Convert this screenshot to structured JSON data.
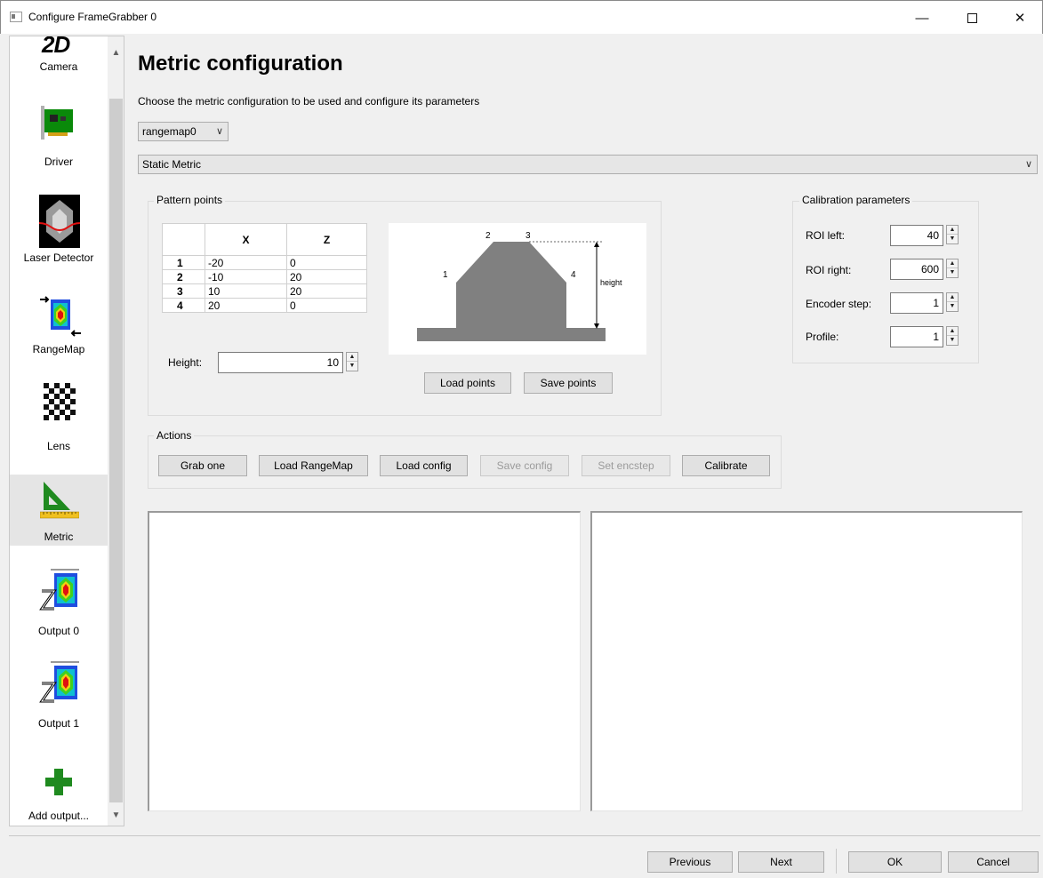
{
  "window": {
    "title": "Configure FrameGrabber 0",
    "minimize": "—",
    "close": "✕"
  },
  "sidebar": {
    "items": [
      {
        "label": "Camera",
        "icon": "2d-camera-icon"
      },
      {
        "label": "Driver",
        "icon": "pci-card-icon"
      },
      {
        "label": "Laser Detector",
        "icon": "laser-detector-icon"
      },
      {
        "label": "RangeMap",
        "icon": "rangemap-icon"
      },
      {
        "label": "Lens",
        "icon": "checkerboard-icon"
      },
      {
        "label": "Metric",
        "icon": "set-square-ruler-icon",
        "selected": true
      },
      {
        "label": "Output 0",
        "icon": "output-z-icon"
      },
      {
        "label": "Output 1",
        "icon": "output-z-icon"
      },
      {
        "label": "Add output...",
        "icon": "green-plus-icon"
      }
    ],
    "camera_glyph": "2D"
  },
  "main": {
    "title": "Metric configuration",
    "subtitle": "Choose the metric configuration to be used and configure its parameters",
    "source_combo": "rangemap0",
    "metric_combo": "Static Metric"
  },
  "pattern_points": {
    "title": "Pattern points",
    "columns": [
      "X",
      "Z"
    ],
    "rows": [
      {
        "id": "1",
        "x": "-20",
        "z": "0"
      },
      {
        "id": "2",
        "x": "-10",
        "z": "20"
      },
      {
        "id": "3",
        "x": "10",
        "z": "20"
      },
      {
        "id": "4",
        "x": "20",
        "z": "0"
      }
    ],
    "height_label": "Height:",
    "height_value": "10",
    "diagram": {
      "labels": [
        "1",
        "2",
        "3",
        "4"
      ],
      "height_text": "height"
    },
    "load_button": "Load points",
    "save_button": "Save points"
  },
  "calibration": {
    "title": "Calibration parameters",
    "fields": [
      {
        "label": "ROI left:",
        "value": "40"
      },
      {
        "label": "ROI right:",
        "value": "600"
      },
      {
        "label": "Encoder step:",
        "value": "1"
      },
      {
        "label": "Profile:",
        "value": "1"
      }
    ]
  },
  "actions": {
    "title": "Actions",
    "buttons": [
      {
        "label": "Grab one",
        "enabled": true
      },
      {
        "label": "Load RangeMap",
        "enabled": true
      },
      {
        "label": "Load config",
        "enabled": true
      },
      {
        "label": "Save config",
        "enabled": false
      },
      {
        "label": "Set encstep",
        "enabled": false
      },
      {
        "label": "Calibrate",
        "enabled": true
      }
    ]
  },
  "footer": {
    "previous": "Previous",
    "next": "Next",
    "ok": "OK",
    "cancel": "Cancel"
  },
  "colors": {
    "accent_green": "#1f8a1f",
    "diagram_gray": "#808080",
    "selected_bg": "#e5e5e5"
  }
}
